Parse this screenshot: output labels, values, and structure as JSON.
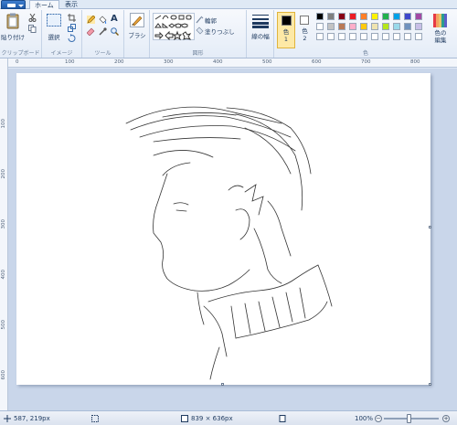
{
  "tabs": [
    {
      "label": "ホーム",
      "active": true
    },
    {
      "label": "表示",
      "active": false
    }
  ],
  "ribbon": {
    "clipboard": {
      "label": "クリップボード",
      "paste": "貼り付け"
    },
    "image": {
      "label": "イメージ",
      "select": "選択"
    },
    "tools": {
      "label": "ツール"
    },
    "brush": {
      "label": "ブラシ"
    },
    "shapes": {
      "label": "図形",
      "outline": "輪郭",
      "fill": "塗りつぶし"
    },
    "size": {
      "label": "線の幅"
    },
    "colors": {
      "label": "色",
      "color1": "色\n1",
      "color2": "色\n2",
      "edit": "色の\n編集",
      "color1_value": "#000000",
      "color2_value": "#ffffff",
      "palette": [
        "#000000",
        "#7f7f7f",
        "#880015",
        "#ed1c24",
        "#ff7f27",
        "#fff200",
        "#22b14c",
        "#00a2e8",
        "#3f48cc",
        "#a349a4",
        "#ffffff",
        "#c3c3c3",
        "#b97a57",
        "#ffaec9",
        "#ffc90e",
        "#efe4b0",
        "#b5e61d",
        "#99d9ea",
        "#7092be",
        "#c8bfe7",
        "#ffffff",
        "#ffffff",
        "#ffffff",
        "#ffffff",
        "#ffffff",
        "#ffffff",
        "#ffffff",
        "#ffffff",
        "#ffffff",
        "#ffffff"
      ]
    }
  },
  "rulers": {
    "top": [
      "0",
      "100",
      "200",
      "300",
      "400",
      "500",
      "600",
      "700",
      "800"
    ],
    "left": [
      "100",
      "200",
      "300",
      "400",
      "500",
      "600"
    ]
  },
  "status": {
    "cursor": "587, 219px",
    "canvas_size": "839 × 636px",
    "zoom": "100%",
    "zoom_minus": "−",
    "zoom_plus": "+"
  }
}
